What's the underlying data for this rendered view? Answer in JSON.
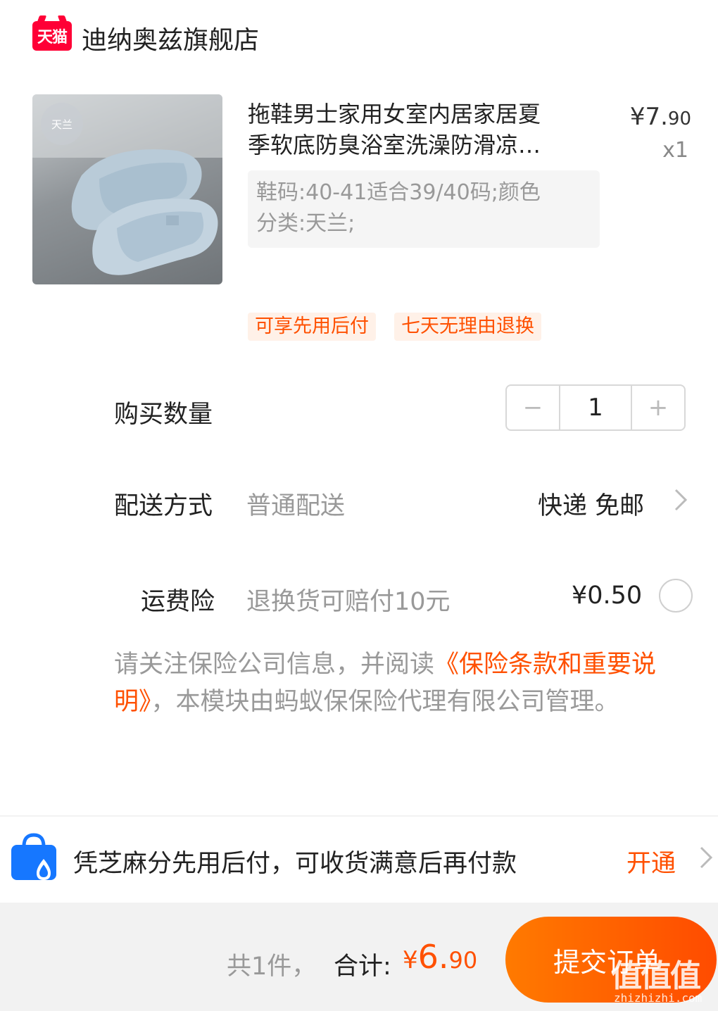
{
  "shop": {
    "logo_text": "天猫",
    "name": "迪纳奥兹旗舰店"
  },
  "product": {
    "image_label": "天兰",
    "title_line1": "拖鞋男士家用女室内居家居夏",
    "title_line2": "季软底防臭浴室洗澡防滑凉…",
    "price_symbol": "¥",
    "price_int": "7.",
    "price_dec": "90",
    "quantity_label": "x1",
    "sku_line1": "鞋码:40-41适合39/40码;颜色",
    "sku_line2": "分类:天兰;",
    "tags": [
      "可享先用后付",
      "七天无理由退换"
    ]
  },
  "quantity": {
    "label": "购买数量",
    "minus": "−",
    "value": "1",
    "plus": "+"
  },
  "shipping": {
    "label": "配送方式",
    "method": "普通配送",
    "value": "快递 免邮"
  },
  "insurance": {
    "label": "运费险",
    "description": "退换货可赔付10元",
    "price": "¥0.50",
    "selected": false
  },
  "notice": {
    "text_before": "请关注保险公司信息，并阅读",
    "link": "《保险条款和重要说明》",
    "text_after": "，本模块由蚂蚁保保险代理有限公司管理。"
  },
  "zhima": {
    "text": "凭芝麻分先用后付，可收货满意后再付款",
    "action": "开通"
  },
  "footer": {
    "count_text": "共1件，",
    "total_label": "合计:",
    "currency": "¥",
    "total_int": "6.",
    "total_dec": "90",
    "submit_label": "提交订单"
  },
  "watermark": {
    "brand": "值值值",
    "url": "zhizhizhi.com"
  },
  "colors": {
    "accent": "#ff5000",
    "tmall_red": "#ff0036",
    "alipay_blue": "#1677ff"
  }
}
